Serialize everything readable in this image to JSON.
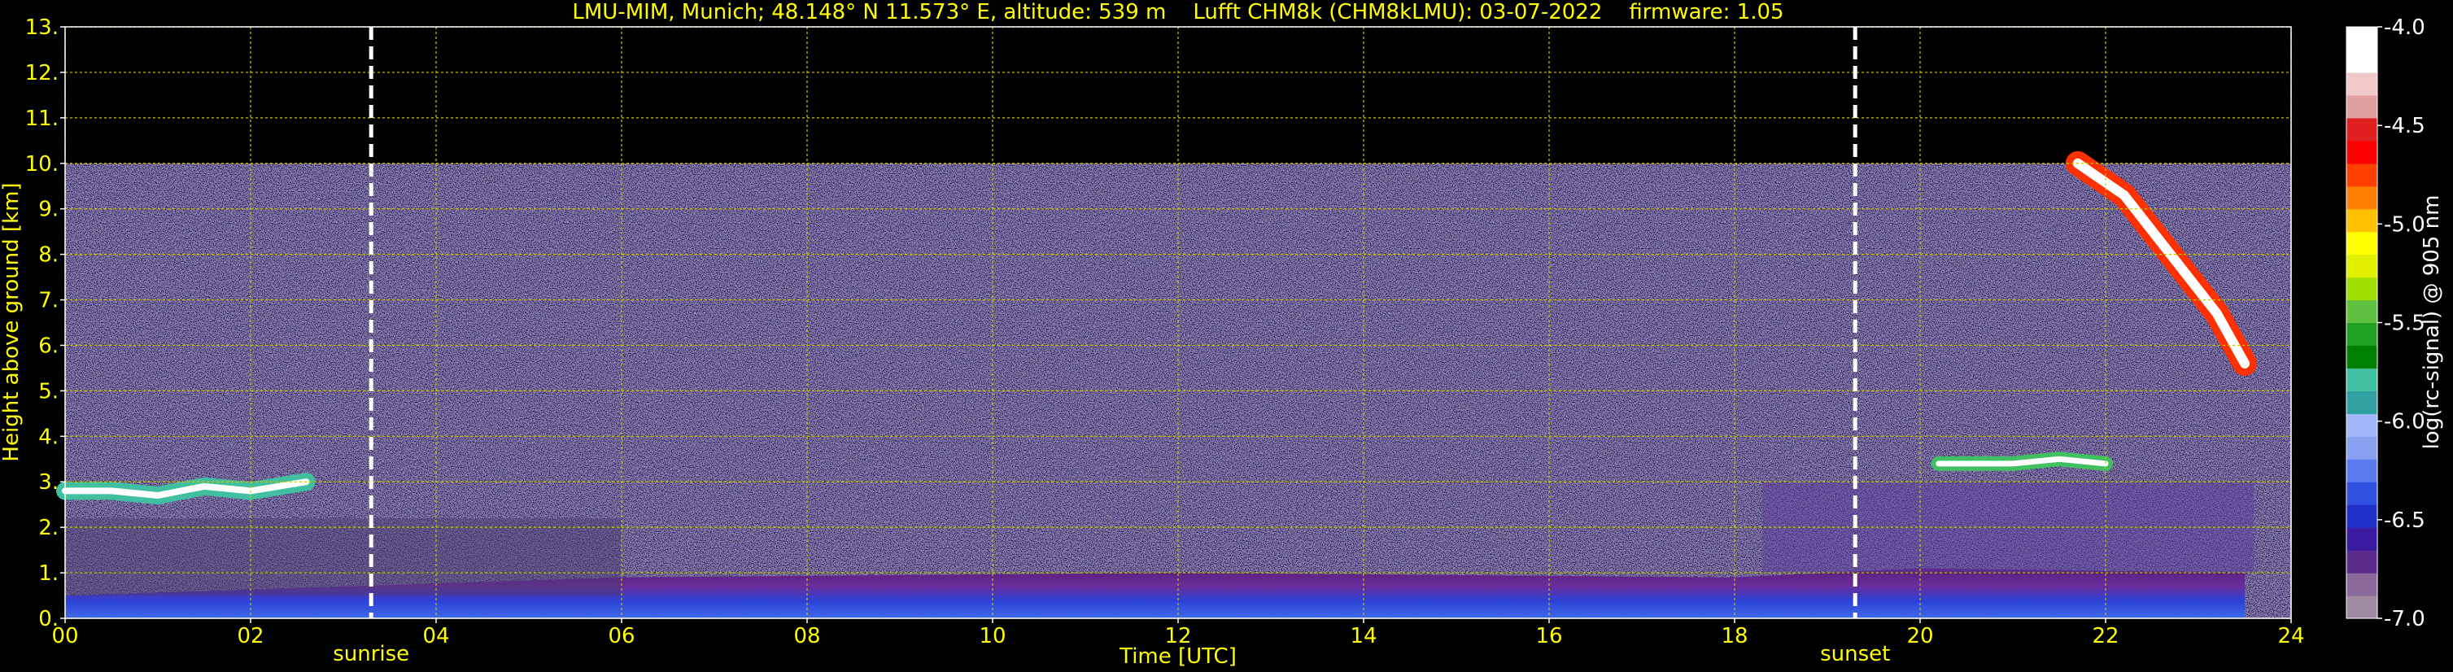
{
  "chart_data": {
    "type": "heatmap",
    "title": "LMU-MIM, Munich; 48.148° N 11.573° E, altitude: 539 m    Lufft CHM8k (CHM8kLMU): 03-07-2022    firmware: 1.05",
    "xlabel": "Time [UTC]",
    "ylabel": "Height above ground [km]",
    "xlim": [
      0,
      24
    ],
    "ylim": [
      0,
      13
    ],
    "x_ticks": [
      "00",
      "02",
      "04",
      "06",
      "08",
      "10",
      "12",
      "14",
      "16",
      "18",
      "20",
      "22",
      "24"
    ],
    "y_ticks": [
      "0.",
      "1.",
      "2.",
      "3.",
      "4.",
      "5.",
      "6.",
      "7.",
      "8.",
      "9.",
      "10.",
      "11.",
      "12.",
      "13."
    ],
    "grid": true,
    "data_top_km": 10,
    "colorbar": {
      "label": "log(rc-signal) @ 905 nm",
      "range": [
        -7.0,
        -4.0
      ],
      "ticks": [
        "-4.0",
        "-4.5",
        "-5.0",
        "-5.5",
        "-6.0",
        "-6.5",
        "-7.0"
      ],
      "colors": [
        "#a08aa0",
        "#8a6a9a",
        "#5a2a8a",
        "#3a1aa0",
        "#2030c8",
        "#3050e0",
        "#5a7aee",
        "#8aa0f0",
        "#a0b8f8",
        "#30a0a0",
        "#40c0a0",
        "#008000",
        "#20a020",
        "#60c040",
        "#a0e000",
        "#e0f000",
        "#ffff00",
        "#ffc000",
        "#ff8000",
        "#ff4000",
        "#ff0000",
        "#e02020",
        "#e0a0a0",
        "#f0c8c8",
        "#ffffff",
        "#ffffff"
      ]
    },
    "events": [
      {
        "label": "sunrise",
        "x": 3.3
      },
      {
        "label": "sunset",
        "x": 19.3
      }
    ],
    "features": {
      "boundary_layer": {
        "x": [
          0,
          6,
          12,
          18,
          20,
          23.5
        ],
        "y": [
          0.5,
          0.9,
          1.0,
          0.9,
          1.1,
          1.0
        ]
      },
      "morning_cloud": {
        "x": [
          0.0,
          0.5,
          1.0,
          1.5,
          2.0,
          2.6
        ],
        "y": [
          2.8,
          2.8,
          2.7,
          2.9,
          2.8,
          3.0
        ]
      },
      "evening_cloud": {
        "x": [
          20.2,
          21.0,
          21.5,
          22.0
        ],
        "y": [
          3.4,
          3.4,
          3.5,
          3.4
        ]
      },
      "cirrus": {
        "x": [
          21.7,
          22.2,
          22.7,
          23.2,
          23.5
        ],
        "y": [
          10.0,
          9.3,
          8.0,
          6.7,
          5.6
        ]
      }
    }
  }
}
